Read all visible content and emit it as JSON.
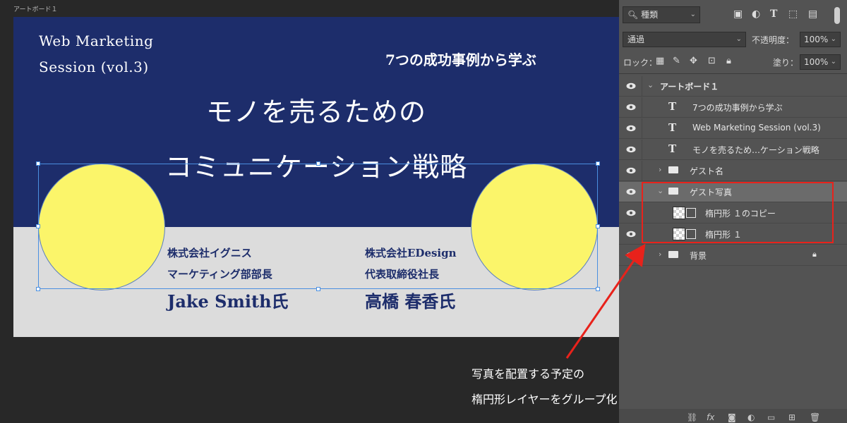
{
  "canvas": {
    "artboard_label": "アートボード１",
    "webinar_title_line1": "Web Marketing",
    "webinar_title_line2": "Session (vol.3)",
    "subtitle": "7つの成功事例から学ぶ",
    "main_title_line1": "モノを売るための",
    "main_title_line2": "コミュニケーション戦略",
    "guest1": {
      "company": "株式会社イグニス",
      "position": "マーケティング部部長",
      "name": "Jake Smith氏"
    },
    "guest2": {
      "company": "株式会社EDesign",
      "position": "代表取締役社長",
      "name": "高橋 春香氏"
    }
  },
  "layers_panel": {
    "filter_kind": "種類",
    "blend_mode": "通過",
    "opacity_label": "不透明度：",
    "opacity_value": "100%",
    "lock_label": "ロック：",
    "fill_label": "塗り：",
    "fill_value": "100%",
    "layers": [
      {
        "name": "アートボード１",
        "type": "artboard"
      },
      {
        "name": "7つの成功事例から学ぶ",
        "type": "text"
      },
      {
        "name": "Web Marketing Session (vol.3)",
        "type": "text"
      },
      {
        "name": "モノを売るため…ケーション戦略",
        "type": "text"
      },
      {
        "name": "ゲスト名",
        "type": "group"
      },
      {
        "name": "ゲスト写真",
        "type": "group"
      },
      {
        "name": "楕円形 １のコピー",
        "type": "shape"
      },
      {
        "name": "楕円形 １",
        "type": "shape"
      },
      {
        "name": "背景",
        "type": "group"
      }
    ]
  },
  "annotation": {
    "line1": "写真を配置する予定の",
    "line2": "楕円形レイヤーをグループ化"
  },
  "colors": {
    "banner": "#1d2d6b",
    "circle": "#fbf56a",
    "highlight": "#e8221b"
  }
}
